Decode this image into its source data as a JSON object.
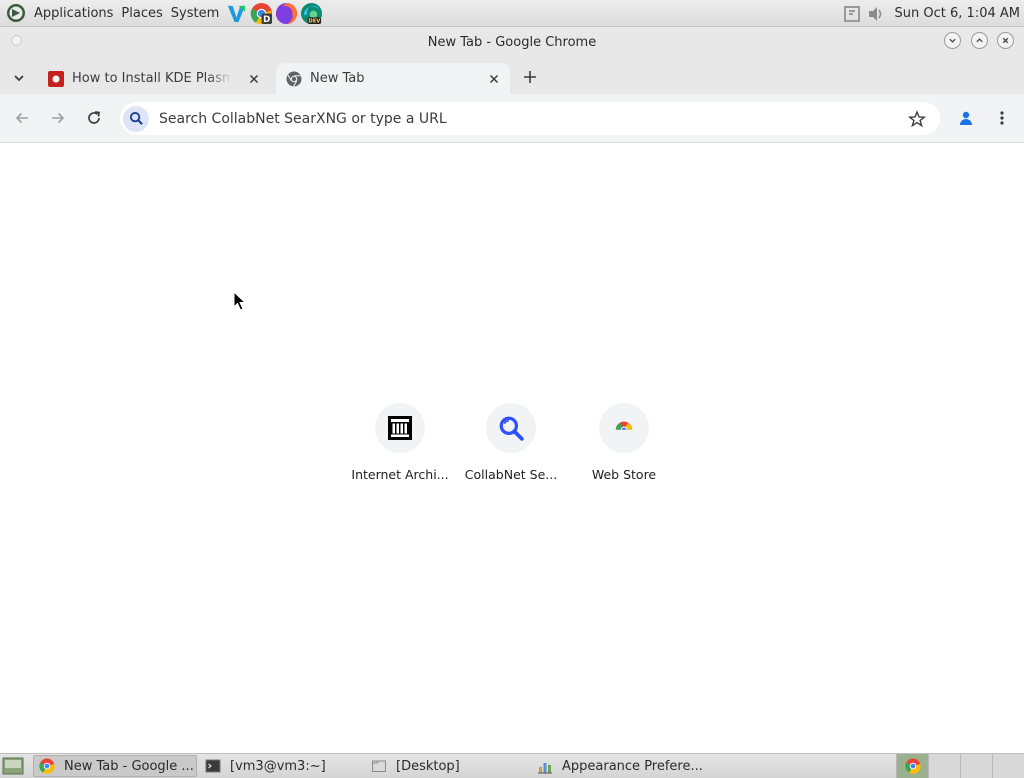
{
  "top_panel": {
    "menus": [
      "Applications",
      "Places",
      "System"
    ],
    "launchers": [
      "vscode-icon",
      "chrome-dev-icon",
      "firefox-icon",
      "edge-dev-icon"
    ],
    "clock": "Sun Oct  6, 1:04 AM"
  },
  "window": {
    "title": "New Tab - Google Chrome"
  },
  "tabs": [
    {
      "title": "How to Install KDE Plasma in",
      "active": false
    },
    {
      "title": "New Tab",
      "active": true
    }
  ],
  "toolbar": {
    "omnibox_placeholder": "Search CollabNet SearXNG or type a URL"
  },
  "shortcuts": [
    {
      "label": "Internet Archi...",
      "icon": "internet-archive-icon"
    },
    {
      "label": "CollabNet Se...",
      "icon": "searxng-icon"
    },
    {
      "label": "Web Store",
      "icon": "chrome-web-store-icon"
    }
  ],
  "taskbar": {
    "tasks": [
      {
        "label": "New Tab - Google ...",
        "icon": "chrome-icon",
        "active": true
      },
      {
        "label": "[vm3@vm3:~]",
        "icon": "terminal-icon",
        "active": false
      },
      {
        "label": "[Desktop]",
        "icon": "folder-icon",
        "active": false
      },
      {
        "label": "Appearance Prefere...",
        "icon": "appearance-icon",
        "active": false
      }
    ]
  },
  "colors": {
    "chrome_frame": "#e8e8e8",
    "toolbar": "#f1f3f4",
    "accent_blue": "#1a73e8",
    "tab_favicon_red": "#c5221f"
  }
}
